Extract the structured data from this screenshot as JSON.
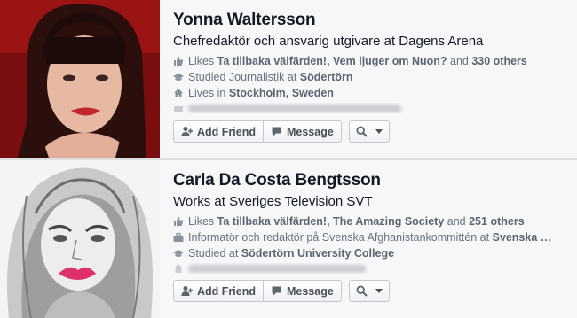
{
  "results": [
    {
      "name": "Yonna Waltersson",
      "subtitle": "Chefredaktör och ansvarig utgivare at Dagens Arena",
      "likes": {
        "prefix": "Likes ",
        "page1": "Ta tillbaka välfärden!",
        "sep": ", ",
        "page2": "Vem ljuger om Nuon?",
        "and": " and ",
        "others": "330 others"
      },
      "studied": {
        "prefix": "Studied Journalistik at ",
        "school": "Södertörn"
      },
      "lives": {
        "prefix": "Lives in ",
        "place": "Stockholm, Sweden"
      },
      "buttons": {
        "add_friend": "Add Friend",
        "message": "Message"
      }
    },
    {
      "name": "Carla Da Costa Bengtsson",
      "subtitle": "Works at Sveriges Television SVT",
      "likes": {
        "prefix": "Likes ",
        "page1": "Ta tillbaka välfärden!",
        "sep": ", ",
        "page2": "The Amazing Society",
        "and": " and ",
        "others": "251 others"
      },
      "work": {
        "prefix": "Informatör och redaktör på Svenska Afghanistankommittén at ",
        "org": "Svenska …"
      },
      "studied": {
        "prefix": "Studied at ",
        "school": "Södertörn University College"
      },
      "buttons": {
        "add_friend": "Add Friend",
        "message": "Message"
      }
    }
  ],
  "colors": {
    "link": "#3b5998",
    "meta_text": "#6a7180",
    "card_bg": "#f6f7f9"
  },
  "icons": [
    "thumbs-up-icon",
    "graduation-cap-icon",
    "house-icon",
    "briefcase-icon",
    "add-friend-icon",
    "message-icon",
    "search-icon",
    "chevron-down-icon"
  ]
}
